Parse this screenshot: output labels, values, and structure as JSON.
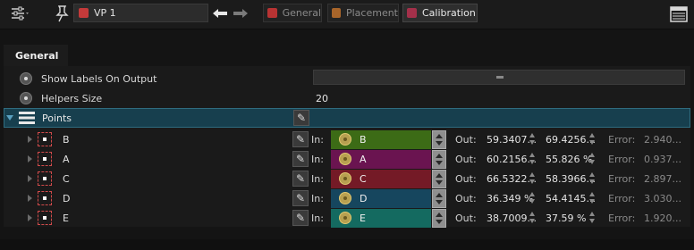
{
  "toolbar": {
    "settings_icon": "sliders-icon",
    "pin_icon": "pin-icon",
    "viewport_name": "VP 1",
    "back_icon": "arrow-left-icon",
    "forward_icon": "arrow-right-icon",
    "tabs": [
      {
        "label": "General",
        "active": false
      },
      {
        "label": "Placement",
        "active": false
      },
      {
        "label": "Calibration",
        "active": true
      }
    ],
    "layout_icon": "panel-layout-icon"
  },
  "panel": {
    "tab_label": "General",
    "show_labels": {
      "label": "Show Labels On Output"
    },
    "helpers_size": {
      "label": "Helpers Size",
      "value": "20"
    },
    "points": {
      "label": "Points"
    }
  },
  "points": [
    {
      "name": "B",
      "in_label": "In:",
      "input": "B",
      "color": "#3c6b16",
      "out_label": "Out:",
      "x": "59.3407...",
      "y": "69.4256...",
      "error_label": "Error:",
      "error": "2.940..."
    },
    {
      "name": "A",
      "in_label": "In:",
      "input": "A",
      "color": "#6a1450",
      "out_label": "Out:",
      "x": "60.2156...",
      "y": "55.826 %",
      "error_label": "Error:",
      "error": "0.937..."
    },
    {
      "name": "C",
      "in_label": "In:",
      "input": "C",
      "color": "#741a26",
      "out_label": "Out:",
      "x": "66.5322...",
      "y": "58.3966...",
      "error_label": "Error:",
      "error": "2.897..."
    },
    {
      "name": "D",
      "in_label": "In:",
      "input": "D",
      "color": "#16465e",
      "out_label": "Out:",
      "x": "36.349 %",
      "y": "54.4145...",
      "error_label": "Error:",
      "error": "3.030..."
    },
    {
      "name": "E",
      "in_label": "In:",
      "input": "E",
      "color": "#146a60",
      "out_label": "Out:",
      "x": "38.7009...",
      "y": "37.59 %",
      "error_label": "Error:",
      "error": "1.920..."
    }
  ]
}
